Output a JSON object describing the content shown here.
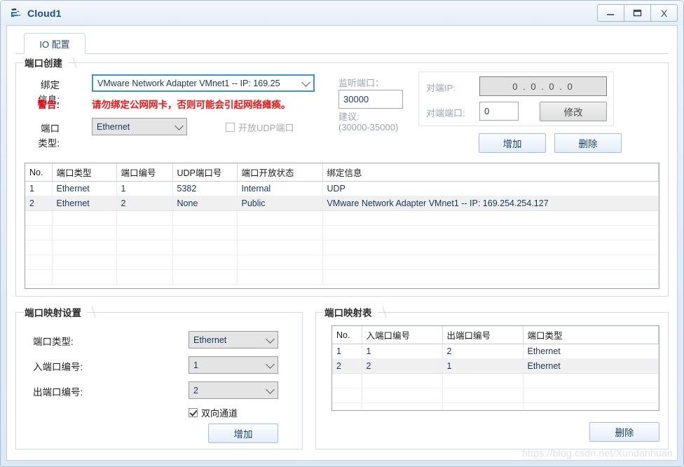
{
  "window": {
    "title": "Cloud1",
    "icon": "cloud-icon",
    "controls": {
      "minimize": "minimize-icon",
      "maximize": "maximize-icon",
      "close": "X"
    }
  },
  "tabs": [
    {
      "label": "IO 配置",
      "active": true
    }
  ],
  "port_create": {
    "legend": "端口创建",
    "binding_label": "绑定信息:",
    "binding_value": "VMware Network Adapter VMnet1 -- IP: 169.25",
    "warning_label": "警告:",
    "warning_text": "请勿绑定公网网卡，否则可能会引起网络瘫痪。",
    "port_type_label": "端口类型:",
    "port_type_value": "Ethernet",
    "udp_checkbox_label": "开放UDP端口",
    "udp_checked": false,
    "listen_port_label": "监听端口：",
    "listen_port_value": "30000",
    "suggest_label": "建议:",
    "suggest_range": "(30000-35000)",
    "peer_ip_label": "对端IP:",
    "peer_ip_value": "0 . 0 . 0 . 0",
    "peer_port_label": "对端端口:",
    "peer_port_value": "0",
    "modify_button": "修改",
    "add_button": "增加",
    "delete_button": "删除"
  },
  "port_table": {
    "headers": [
      "No.",
      "端口类型",
      "端口编号",
      "UDP端口号",
      "端口开放状态",
      "绑定信息"
    ],
    "rows": [
      [
        "1",
        "Ethernet",
        "1",
        "5382",
        "Internal",
        "UDP"
      ],
      [
        "2",
        "Ethernet",
        "2",
        "None",
        "Public",
        "VMware Network Adapter VMnet1 -- IP: 169.254.254.127"
      ]
    ],
    "empty_rows": 5
  },
  "mapping_settings": {
    "legend": "端口映射设置",
    "port_type_label": "端口类型:",
    "port_type_value": "Ethernet",
    "in_port_label": "入端口编号:",
    "in_port_value": "1",
    "out_port_label": "出端口编号:",
    "out_port_value": "2",
    "bidirectional_label": "双向通道",
    "bidirectional_checked": true,
    "add_button": "增加"
  },
  "mapping_table": {
    "legend": "端口映射表",
    "headers": [
      "No.",
      "入端口编号",
      "出端口编号",
      "端口类型"
    ],
    "rows": [
      [
        "1",
        "1",
        "2",
        "Ethernet"
      ],
      [
        "2",
        "2",
        "1",
        "Ethernet"
      ]
    ],
    "empty_rows": 4,
    "delete_button": "删除"
  },
  "watermark": "https://blog.csdn.net/Xundanhuan",
  "colors": {
    "title_text": "#1a4b8c",
    "warning": "#f01414",
    "grid_text": "#17365d",
    "accent_border": "#a6bdd4"
  }
}
